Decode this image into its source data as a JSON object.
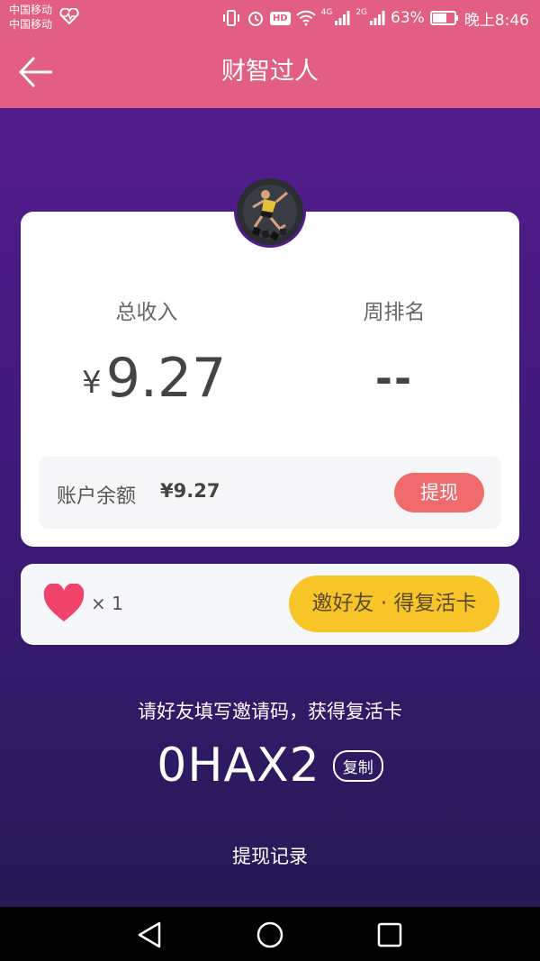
{
  "status_bar": {
    "carrier_1": "中国移动",
    "carrier_2": "中国移动",
    "hd": "HD",
    "net_1": "4G",
    "net_2": "2G",
    "battery": "63%",
    "time": "晚上8:46"
  },
  "header": {
    "title": "财智过人"
  },
  "stats": {
    "income_label": "总收入",
    "income_currency": "¥",
    "income_value": "9.27",
    "rank_label": "周排名",
    "rank_value": "--"
  },
  "balance": {
    "label": "账户余额",
    "value": "¥9.27",
    "withdraw_label": "提现"
  },
  "lives": {
    "count": "× 1",
    "invite_label": "邀好友 · 得复活卡"
  },
  "invite": {
    "hint": "请好友填写邀请码，获得复活卡",
    "code": "0HAX2",
    "copy_label": "复制"
  },
  "records_link": "提现记录",
  "colors": {
    "header": "#e25f83",
    "gradient_top": "#531c8c",
    "gradient_bottom": "#261a55",
    "withdraw_button": "#ee6a6c",
    "invite_button": "#f8c529",
    "heart": "#f0436a"
  },
  "icons": [
    "back-arrow-icon",
    "heart-icon",
    "avatar",
    "nav-back-icon",
    "nav-home-icon",
    "nav-recents-icon"
  ]
}
